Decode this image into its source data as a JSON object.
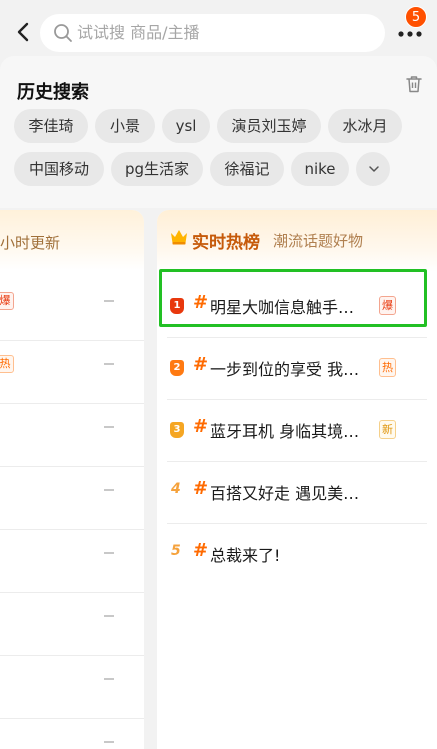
{
  "header": {
    "search_placeholder": "试试搜 商品/主播",
    "badge_count": "5",
    "icons": [
      "chevron-left-icon",
      "search-icon",
      "more-dots-icon"
    ]
  },
  "history": {
    "title": "历史搜索",
    "chips": [
      "李佳琦",
      "小景",
      "ysl",
      "演员刘玉婷",
      "水冰月",
      "中国移动",
      "pg生活家",
      "徐福记",
      "nike"
    ]
  },
  "left_card": {
    "title": "小时更新",
    "tags": [
      "爆",
      "热"
    ]
  },
  "right_card": {
    "title": "实时热榜",
    "subtitle": "潮流话题好物",
    "items": [
      {
        "rank": "1",
        "title": "明星大咖信息触手…",
        "tag": "爆"
      },
      {
        "rank": "2",
        "title": "一步到位的享受 我…",
        "tag": "热"
      },
      {
        "rank": "3",
        "title": "蓝牙耳机 身临其境…",
        "tag": "新"
      },
      {
        "rank": "4",
        "title": "百搭又好走 遇见美…",
        "tag": ""
      },
      {
        "rank": "5",
        "title": "总裁来了!",
        "tag": ""
      }
    ]
  },
  "colors": {
    "accent": "#ff6a00",
    "badge": "#ff5000",
    "highlight": "#22c024",
    "tag_hot": "#ff6a00",
    "tag_boom": "#e8380d",
    "tag_new": "#f5a623"
  }
}
